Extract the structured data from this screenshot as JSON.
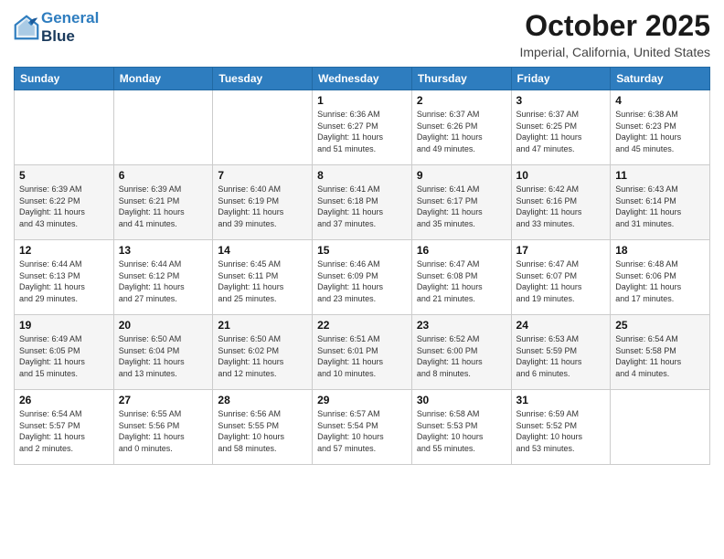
{
  "header": {
    "logo": {
      "line1": "General",
      "line2": "Blue"
    },
    "month": "October 2025",
    "location": "Imperial, California, United States"
  },
  "weekdays": [
    "Sunday",
    "Monday",
    "Tuesday",
    "Wednesday",
    "Thursday",
    "Friday",
    "Saturday"
  ],
  "weeks": [
    [
      {
        "day": "",
        "info": ""
      },
      {
        "day": "",
        "info": ""
      },
      {
        "day": "",
        "info": ""
      },
      {
        "day": "1",
        "info": "Sunrise: 6:36 AM\nSunset: 6:27 PM\nDaylight: 11 hours\nand 51 minutes."
      },
      {
        "day": "2",
        "info": "Sunrise: 6:37 AM\nSunset: 6:26 PM\nDaylight: 11 hours\nand 49 minutes."
      },
      {
        "day": "3",
        "info": "Sunrise: 6:37 AM\nSunset: 6:25 PM\nDaylight: 11 hours\nand 47 minutes."
      },
      {
        "day": "4",
        "info": "Sunrise: 6:38 AM\nSunset: 6:23 PM\nDaylight: 11 hours\nand 45 minutes."
      }
    ],
    [
      {
        "day": "5",
        "info": "Sunrise: 6:39 AM\nSunset: 6:22 PM\nDaylight: 11 hours\nand 43 minutes."
      },
      {
        "day": "6",
        "info": "Sunrise: 6:39 AM\nSunset: 6:21 PM\nDaylight: 11 hours\nand 41 minutes."
      },
      {
        "day": "7",
        "info": "Sunrise: 6:40 AM\nSunset: 6:19 PM\nDaylight: 11 hours\nand 39 minutes."
      },
      {
        "day": "8",
        "info": "Sunrise: 6:41 AM\nSunset: 6:18 PM\nDaylight: 11 hours\nand 37 minutes."
      },
      {
        "day": "9",
        "info": "Sunrise: 6:41 AM\nSunset: 6:17 PM\nDaylight: 11 hours\nand 35 minutes."
      },
      {
        "day": "10",
        "info": "Sunrise: 6:42 AM\nSunset: 6:16 PM\nDaylight: 11 hours\nand 33 minutes."
      },
      {
        "day": "11",
        "info": "Sunrise: 6:43 AM\nSunset: 6:14 PM\nDaylight: 11 hours\nand 31 minutes."
      }
    ],
    [
      {
        "day": "12",
        "info": "Sunrise: 6:44 AM\nSunset: 6:13 PM\nDaylight: 11 hours\nand 29 minutes."
      },
      {
        "day": "13",
        "info": "Sunrise: 6:44 AM\nSunset: 6:12 PM\nDaylight: 11 hours\nand 27 minutes."
      },
      {
        "day": "14",
        "info": "Sunrise: 6:45 AM\nSunset: 6:11 PM\nDaylight: 11 hours\nand 25 minutes."
      },
      {
        "day": "15",
        "info": "Sunrise: 6:46 AM\nSunset: 6:09 PM\nDaylight: 11 hours\nand 23 minutes."
      },
      {
        "day": "16",
        "info": "Sunrise: 6:47 AM\nSunset: 6:08 PM\nDaylight: 11 hours\nand 21 minutes."
      },
      {
        "day": "17",
        "info": "Sunrise: 6:47 AM\nSunset: 6:07 PM\nDaylight: 11 hours\nand 19 minutes."
      },
      {
        "day": "18",
        "info": "Sunrise: 6:48 AM\nSunset: 6:06 PM\nDaylight: 11 hours\nand 17 minutes."
      }
    ],
    [
      {
        "day": "19",
        "info": "Sunrise: 6:49 AM\nSunset: 6:05 PM\nDaylight: 11 hours\nand 15 minutes."
      },
      {
        "day": "20",
        "info": "Sunrise: 6:50 AM\nSunset: 6:04 PM\nDaylight: 11 hours\nand 13 minutes."
      },
      {
        "day": "21",
        "info": "Sunrise: 6:50 AM\nSunset: 6:02 PM\nDaylight: 11 hours\nand 12 minutes."
      },
      {
        "day": "22",
        "info": "Sunrise: 6:51 AM\nSunset: 6:01 PM\nDaylight: 11 hours\nand 10 minutes."
      },
      {
        "day": "23",
        "info": "Sunrise: 6:52 AM\nSunset: 6:00 PM\nDaylight: 11 hours\nand 8 minutes."
      },
      {
        "day": "24",
        "info": "Sunrise: 6:53 AM\nSunset: 5:59 PM\nDaylight: 11 hours\nand 6 minutes."
      },
      {
        "day": "25",
        "info": "Sunrise: 6:54 AM\nSunset: 5:58 PM\nDaylight: 11 hours\nand 4 minutes."
      }
    ],
    [
      {
        "day": "26",
        "info": "Sunrise: 6:54 AM\nSunset: 5:57 PM\nDaylight: 11 hours\nand 2 minutes."
      },
      {
        "day": "27",
        "info": "Sunrise: 6:55 AM\nSunset: 5:56 PM\nDaylight: 11 hours\nand 0 minutes."
      },
      {
        "day": "28",
        "info": "Sunrise: 6:56 AM\nSunset: 5:55 PM\nDaylight: 10 hours\nand 58 minutes."
      },
      {
        "day": "29",
        "info": "Sunrise: 6:57 AM\nSunset: 5:54 PM\nDaylight: 10 hours\nand 57 minutes."
      },
      {
        "day": "30",
        "info": "Sunrise: 6:58 AM\nSunset: 5:53 PM\nDaylight: 10 hours\nand 55 minutes."
      },
      {
        "day": "31",
        "info": "Sunrise: 6:59 AM\nSunset: 5:52 PM\nDaylight: 10 hours\nand 53 minutes."
      },
      {
        "day": "",
        "info": ""
      }
    ]
  ]
}
